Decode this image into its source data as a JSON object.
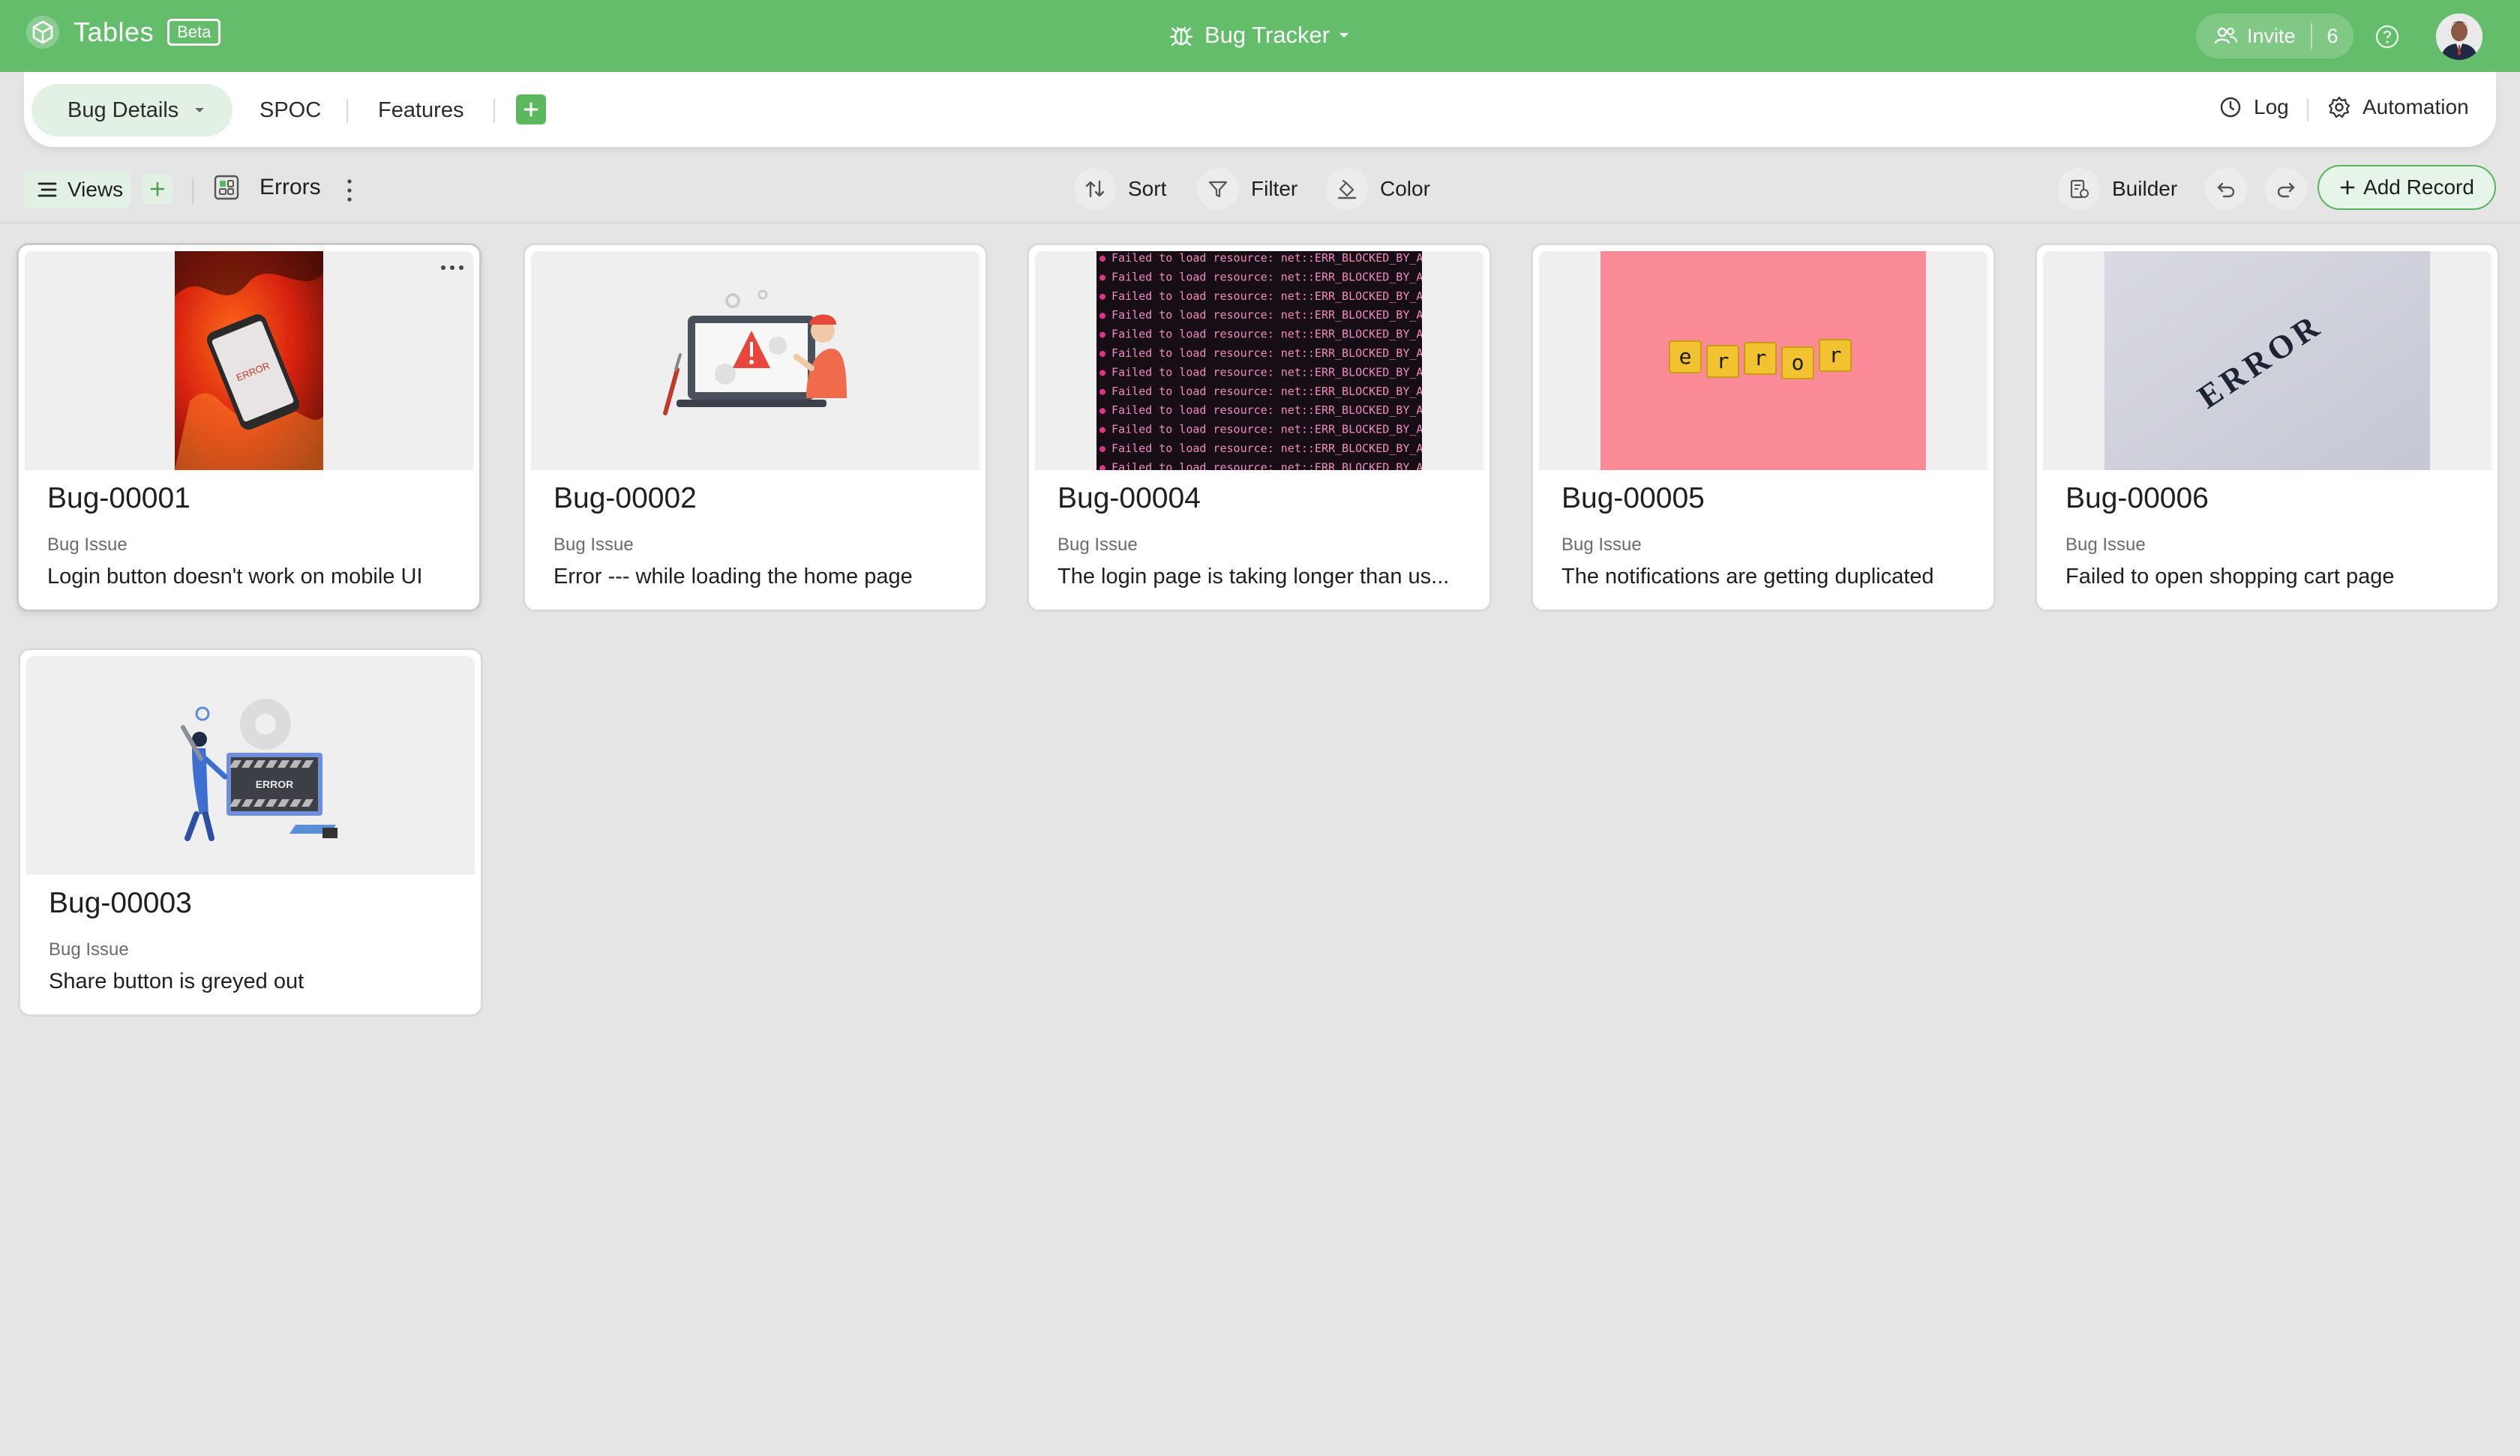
{
  "app": {
    "name": "Tables",
    "badge": "Beta",
    "base_title": "Bug Tracker",
    "invite_label": "Invite",
    "invite_count": "6"
  },
  "tabs": [
    {
      "label": "Bug Details",
      "active": true
    },
    {
      "label": "SPOC"
    },
    {
      "label": "Features"
    }
  ],
  "tab_actions": {
    "log": "Log",
    "automation": "Automation"
  },
  "toolbar": {
    "views": "Views",
    "view_name": "Errors",
    "sort": "Sort",
    "filter": "Filter",
    "color": "Color",
    "builder": "Builder",
    "add_record": "Add Record"
  },
  "cards": [
    {
      "title": "Bug-00001",
      "field_label": "Bug Issue",
      "value": "Login button doesn't work on mobile UI",
      "cover": "phone-error-photo"
    },
    {
      "title": "Bug-00002",
      "field_label": "Bug Issue",
      "value": "Error --- while loading the home page",
      "cover": "laptop-warning-illustration"
    },
    {
      "title": "Bug-00004",
      "field_label": "Bug Issue",
      "value": "The login page is taking longer than us...",
      "cover": "console-errors-screenshot"
    },
    {
      "title": "Bug-00005",
      "field_label": "Bug Issue",
      "value": "The notifications are getting duplicated",
      "cover": "error-letter-tiles-photo"
    },
    {
      "title": "Bug-00006",
      "field_label": "Bug Issue",
      "value": "Failed to open shopping cart page",
      "cover": "error-text-photo"
    },
    {
      "title": "Bug-00003",
      "field_label": "Bug Issue",
      "value": "Share button is greyed out",
      "cover": "error-repair-illustration"
    }
  ],
  "console_line": "Failed to load resource: net::ERR_BLOCKED_BY_AD",
  "tiles_text": [
    "e",
    "r",
    "r",
    "o",
    "r"
  ],
  "cover_texts": {
    "phone_screen": "ERROR",
    "angled_word": "ERROR",
    "panel_word": "ERROR"
  },
  "colors": {
    "brand_green": "#63bd6b",
    "active_tab_bg": "#e3f1e4",
    "page_bg": "#e5e5e5"
  }
}
